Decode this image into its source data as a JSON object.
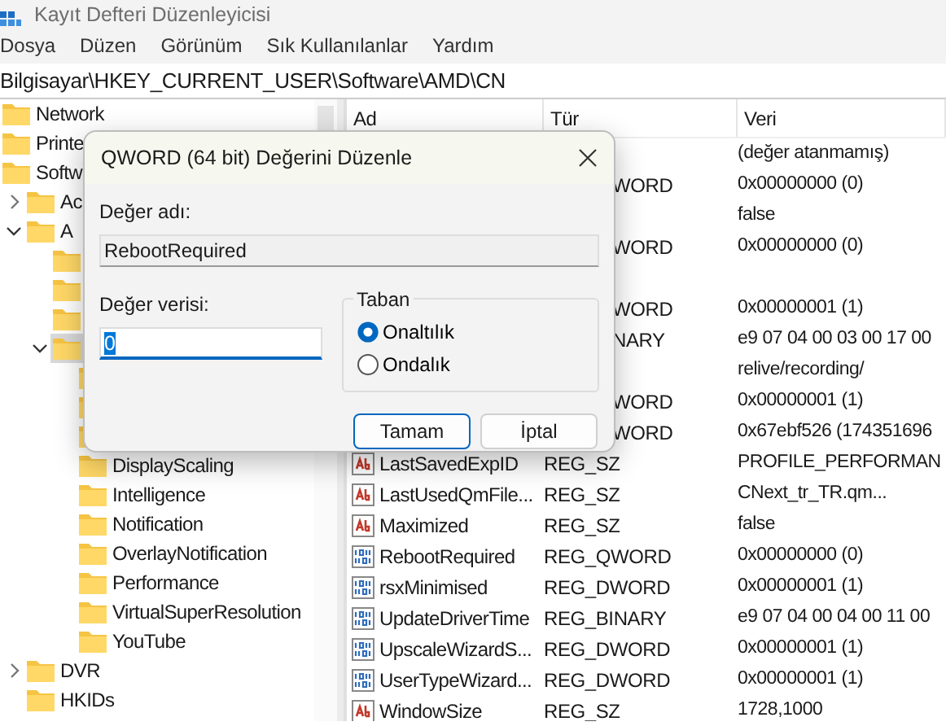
{
  "window": {
    "title": "Kayıt Defteri Düzenleyicisi"
  },
  "menu": [
    "Dosya",
    "Düzen",
    "Görünüm",
    "Sık Kullanılanlar",
    "Yardım"
  ],
  "address": "Bilgisayar\\HKEY_CURRENT_USER\\Software\\AMD\\CN",
  "tree": [
    {
      "label": "Network",
      "selected": false
    },
    {
      "label": "Printe",
      "selected": false
    },
    {
      "label": "Softw",
      "selected": false,
      "children": [
        {
          "label": "Ac",
          "selected": false,
          "expanded": false
        },
        {
          "label": "A",
          "selected": false,
          "expanded": true,
          "children": [
            {
              "selected": false
            },
            {
              "selected": false
            },
            {
              "selected": false
            },
            {
              "selected": true,
              "expanded": true,
              "children": [
                {
                  "selected": false
                },
                {
                  "selected": false
                },
                {
                  "selected": false
                },
                {
                  "label": "DisplayScaling",
                  "selected": false
                },
                {
                  "label": "Intelligence",
                  "selected": false
                },
                {
                  "label": "Notification",
                  "selected": false
                },
                {
                  "label": "OverlayNotification",
                  "selected": false
                },
                {
                  "label": "Performance",
                  "selected": false
                },
                {
                  "label": "VirtualSuperResolution",
                  "selected": false
                },
                {
                  "label": "YouTube",
                  "selected": false
                }
              ]
            }
          ]
        },
        {
          "label": "DVR",
          "selected": false,
          "expanded": false
        },
        {
          "label": "HKIDs",
          "selected": false
        }
      ]
    }
  ],
  "table": {
    "columns": [
      "Ad",
      "Tür",
      "Veri"
    ],
    "rows": [
      {
        "kind": "covered",
        "data": "(değer atanmamış)"
      },
      {
        "kind": "covered",
        "type": "WORD",
        "data": "0x00000000 (0)"
      },
      {
        "kind": "covered",
        "data": "false"
      },
      {
        "kind": "covered",
        "type": "WORD",
        "data": "0x00000000 (0)"
      },
      {
        "kind": "covered"
      },
      {
        "kind": "covered",
        "type": "WORD",
        "data": "0x00000001 (1)"
      },
      {
        "kind": "covered",
        "type": "NARY",
        "data": "e9 07 04 00 03 00 17 00"
      },
      {
        "kind": "covered",
        "data": "relive/recording/"
      },
      {
        "kind": "covered",
        "type": "WORD",
        "data": "0x00000001 (1)"
      },
      {
        "kind": "covered",
        "type": "WORD",
        "data": "0x67ebf526 (174351696"
      },
      {
        "kind": "string",
        "name": "LastSavedExpID",
        "type": "REG_SZ",
        "data": "PROFILE_PERFORMAN"
      },
      {
        "kind": "string",
        "name": "LastUsedQmFile...",
        "type": "REG_SZ",
        "data": "CNext_tr_TR.qm..."
      },
      {
        "kind": "string",
        "name": "Maximized",
        "type": "REG_SZ",
        "data": "false"
      },
      {
        "kind": "binary",
        "name": "RebootRequired",
        "type": "REG_QWORD",
        "data": "0x00000000 (0)"
      },
      {
        "kind": "binary",
        "name": "rsxMinimised",
        "type": "REG_DWORD",
        "data": "0x00000001 (1)"
      },
      {
        "kind": "binary",
        "name": "UpdateDriverTime",
        "type": "REG_BINARY",
        "data": "e9 07 04 00 04 00 11 00"
      },
      {
        "kind": "binary",
        "name": "UpscaleWizardS...",
        "type": "REG_DWORD",
        "data": "0x00000001 (1)"
      },
      {
        "kind": "binary",
        "name": "UserTypeWizard...",
        "type": "REG_DWORD",
        "data": "0x00000001 (1)"
      },
      {
        "kind": "string",
        "name": "WindowSize",
        "type": "REG_SZ",
        "data": "1728,1000"
      }
    ]
  },
  "dialog": {
    "title": "QWORD (64 bit) Değerini Düzenle",
    "name_label": "Değer adı:",
    "name_value": "RebootRequired",
    "data_label": "Değer verisi:",
    "data_value": "0",
    "base_group": "Taban",
    "bases": [
      {
        "label": "Onaltılık",
        "selected": true
      },
      {
        "label": "Ondalık",
        "selected": false
      }
    ],
    "buttons": [
      {
        "label": "Tamam",
        "kind": "default"
      },
      {
        "label": "İptal",
        "kind": "normal"
      }
    ]
  }
}
